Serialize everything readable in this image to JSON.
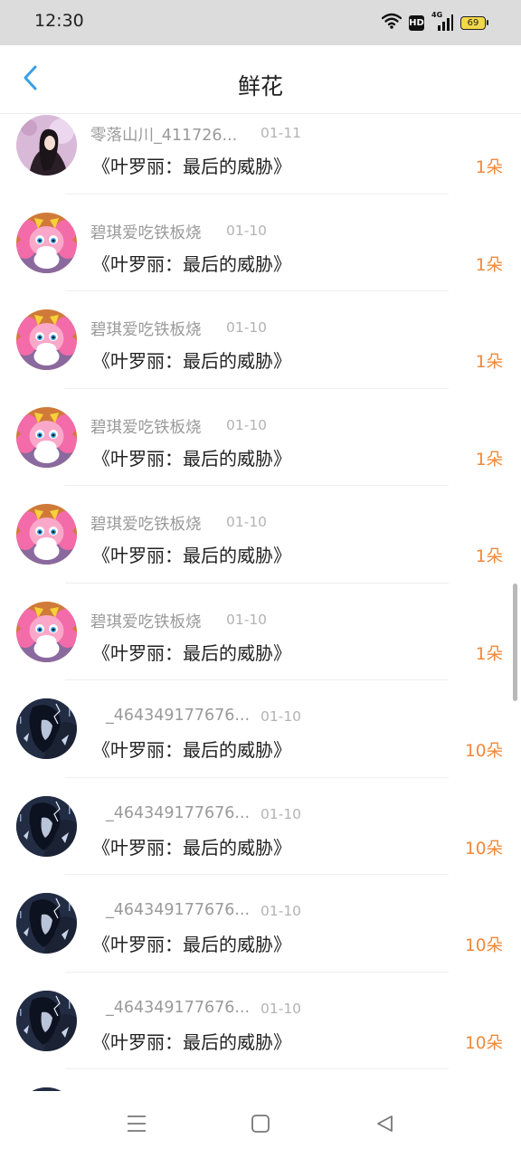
{
  "status_bar": {
    "time": "12:30",
    "hd_label": "HD",
    "network_label": "4G",
    "battery_level": "69",
    "icons": [
      "wifi-icon",
      "hd-icon",
      "signal-icon",
      "battery-icon"
    ]
  },
  "header": {
    "title": "鲜花",
    "back_icon": "chevron-left-icon",
    "accent_color": "#3a9fe6"
  },
  "list": {
    "items": [
      {
        "user": "零落山川_411726...",
        "date": "01-11",
        "book": "《叶罗丽：最后的威胁》",
        "count": "1朵",
        "avatar": "girl-photo"
      },
      {
        "user": "碧琪爱吃铁板烧",
        "date": "01-10",
        "book": "《叶罗丽：最后的威胁》",
        "count": "1朵",
        "avatar": "pink-pony"
      },
      {
        "user": "碧琪爱吃铁板烧",
        "date": "01-10",
        "book": "《叶罗丽：最后的威胁》",
        "count": "1朵",
        "avatar": "pink-pony"
      },
      {
        "user": "碧琪爱吃铁板烧",
        "date": "01-10",
        "book": "《叶罗丽：最后的威胁》",
        "count": "1朵",
        "avatar": "pink-pony"
      },
      {
        "user": "碧琪爱吃铁板烧",
        "date": "01-10",
        "book": "《叶罗丽：最后的威胁》",
        "count": "1朵",
        "avatar": "pink-pony"
      },
      {
        "user": "碧琪爱吃铁板烧",
        "date": "01-10",
        "book": "《叶罗丽：最后的威胁》",
        "count": "1朵",
        "avatar": "pink-pony"
      },
      {
        "user": "_464349177676...",
        "date": "01-10",
        "book": "《叶罗丽：最后的威胁》",
        "count": "10朵",
        "avatar": "dark-anime"
      },
      {
        "user": "_464349177676...",
        "date": "01-10",
        "book": "《叶罗丽：最后的威胁》",
        "count": "10朵",
        "avatar": "dark-anime"
      },
      {
        "user": "_464349177676...",
        "date": "01-10",
        "book": "《叶罗丽：最后的威胁》",
        "count": "10朵",
        "avatar": "dark-anime"
      },
      {
        "user": "_464349177676...",
        "date": "01-10",
        "book": "《叶罗丽：最后的威胁》",
        "count": "10朵",
        "avatar": "dark-anime"
      },
      {
        "user": "",
        "date": "",
        "book": "",
        "count": "",
        "avatar": "dark-anime"
      }
    ]
  },
  "colors": {
    "count_color": "#f0883a",
    "name_color": "#9a9a9a",
    "title_color": "#222222"
  },
  "nav_bar": {
    "buttons": [
      "menu-icon",
      "home-square-icon",
      "back-triangle-icon"
    ]
  }
}
